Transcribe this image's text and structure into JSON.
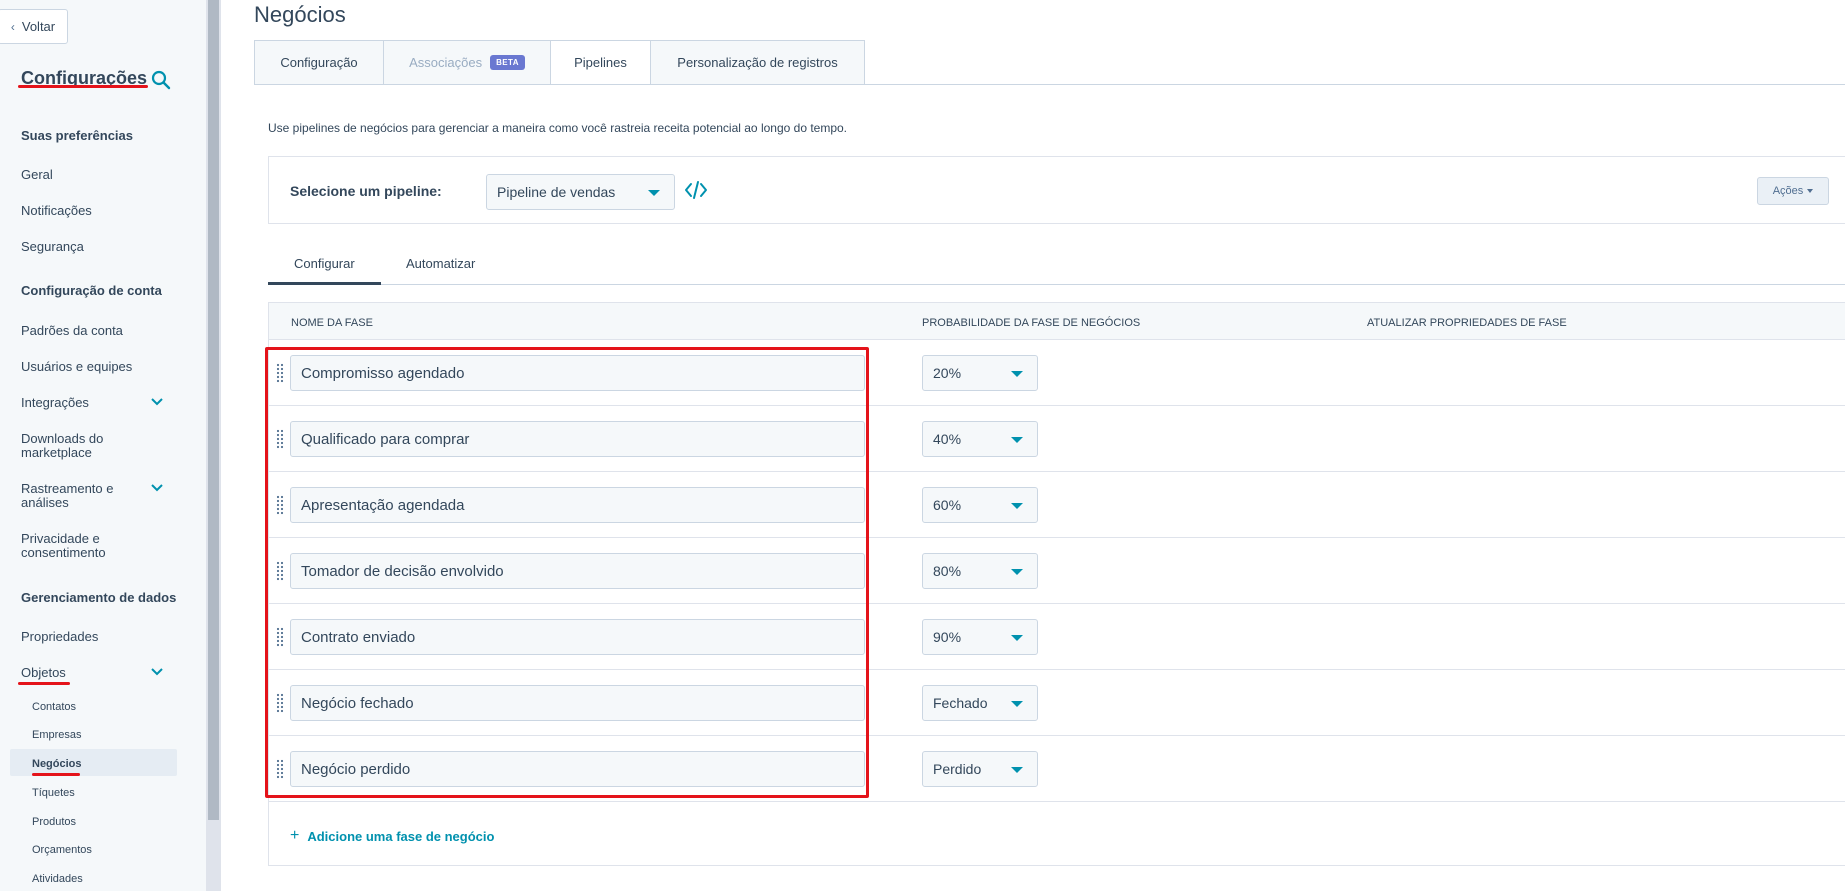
{
  "sidebar": {
    "back_label": "Voltar",
    "title": "Configurações",
    "sections": {
      "prefs": "Suas preferências",
      "account": "Configuração de conta",
      "data": "Gerenciamento de dados"
    },
    "items": {
      "geral": "Geral",
      "notificacoes": "Notificações",
      "seguranca": "Segurança",
      "padroes": "Padrões da conta",
      "usuarios": "Usuários e equipes",
      "integracoes": "Integrações",
      "downloads_1": "Downloads do",
      "downloads_2": "marketplace",
      "rastreamento_1": "Rastreamento e",
      "rastreamento_2": "análises",
      "privacidade_1": "Privacidade e",
      "privacidade_2": "consentimento",
      "propriedades": "Propriedades",
      "objetos": "Objetos"
    },
    "sub_items": {
      "contatos": "Contatos",
      "empresas": "Empresas",
      "negocios": "Negócios",
      "tiquetes": "Tíquetes",
      "produtos": "Produtos",
      "orcamentos": "Orçamentos",
      "atividades": "Atividades"
    }
  },
  "main": {
    "title": "Negócios",
    "tabs": {
      "configuracao": "Configuração",
      "associacoes": "Associações",
      "beta": "BETA",
      "pipelines": "Pipelines",
      "personalizacao": "Personalização de registros"
    },
    "description": "Use pipelines de negócios para gerenciar a maneira como você rastreia receita potencial ao longo do tempo.",
    "pipeline_label": "Selecione um pipeline:",
    "pipeline_value": "Pipeline de vendas",
    "actions_label": "Ações",
    "subtabs": {
      "configurar": "Configurar",
      "automatizar": "Automatizar"
    },
    "columns": {
      "stage": "NOME DA FASE",
      "probability": "PROBABILIDADE DA FASE DE NEGÓCIOS",
      "update": "ATUALIZAR PROPRIEDADES DE FASE"
    },
    "stages": [
      {
        "name": "Compromisso agendado",
        "prob": "20%"
      },
      {
        "name": "Qualificado para comprar",
        "prob": "40%"
      },
      {
        "name": "Apresentação agendada",
        "prob": "60%"
      },
      {
        "name": "Tomador de decisão envolvido",
        "prob": "80%"
      },
      {
        "name": "Contrato enviado",
        "prob": "90%"
      },
      {
        "name": "Negócio fechado",
        "prob": "Fechado"
      },
      {
        "name": "Negócio perdido",
        "prob": "Perdido"
      }
    ],
    "add_stage_label": "Adicione uma fase de negócio"
  },
  "colors": {
    "accent": "#0091ae",
    "highlight": "#e4131a",
    "text": "#33475b",
    "beta_badge": "#6a78d1"
  }
}
